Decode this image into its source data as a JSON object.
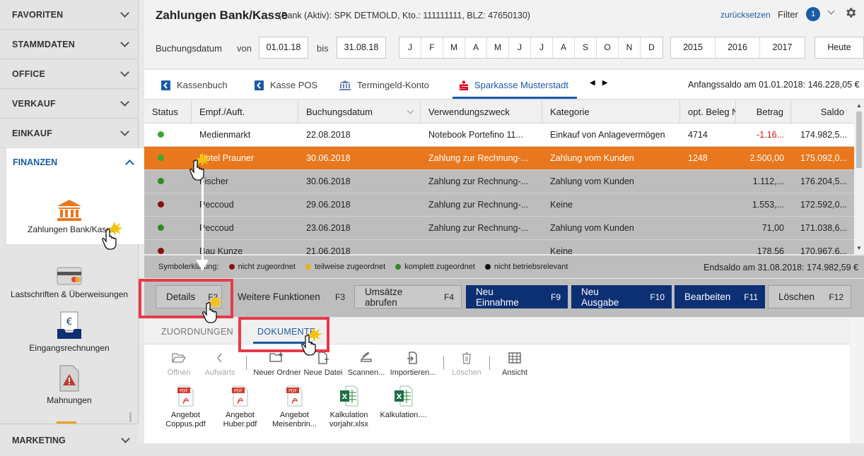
{
  "sidebar": {
    "items": [
      {
        "label": "FAVORITEN"
      },
      {
        "label": "STAMMDATEN"
      },
      {
        "label": "OFFICE"
      },
      {
        "label": "VERKAUF"
      },
      {
        "label": "EINKAUF"
      }
    ],
    "finanzen": {
      "label": "FINANZEN",
      "app_label": "Zahlungen Bank/Kasse"
    },
    "sub_items": [
      {
        "label": "Lastschriften & Überweisungen"
      },
      {
        "label": "Eingangsrechnungen"
      },
      {
        "label": "Mahnungen"
      }
    ],
    "marketing": {
      "label": "MARKETING"
    }
  },
  "header": {
    "title": "Zahlungen Bank/Kasse",
    "subtitle": "(Bank (Aktiv): SPK DETMOLD, Kto.: 111111111, BLZ: 47650130)",
    "reset": "zurücksetzen",
    "filter": "Filter",
    "filter_count": "1",
    "buchungsdatum_label": "Buchungsdatum",
    "von": "von",
    "bis": "bis",
    "date_from": "01.01.18",
    "date_to": "31.08.18",
    "months": [
      "J",
      "F",
      "M",
      "A",
      "M",
      "J",
      "J",
      "A",
      "S",
      "O",
      "N",
      "D"
    ],
    "years": [
      "2015",
      "2016",
      "2017"
    ],
    "heute": "Heute"
  },
  "tabs": {
    "items": [
      {
        "label": "Kassenbuch"
      },
      {
        "label": "Kasse POS"
      },
      {
        "label": "Termingeld-Konto"
      },
      {
        "label": "Sparkasse Musterstadt"
      }
    ],
    "anfangssaldo": "Anfangssaldo am 01.01.2018: 146.228,05 €"
  },
  "table": {
    "headers": [
      "Status",
      "Empf./Auft.",
      "Buchungsdatum",
      "Verwendungszweck",
      "Kategorie",
      "opt. Beleg N",
      "Betrag",
      "Saldo"
    ],
    "rows": [
      {
        "status_color": "#3aa82c",
        "empf": "Medienmarkt",
        "datum": "22.08.2018",
        "zweck": "Notebook Portefino 11...",
        "kategorie": "Einkauf von Anlagevermögen",
        "beleg": "4714",
        "betrag": "-1.16...",
        "saldo": "174.982,5..."
      },
      {
        "status_color": "#3aa82c",
        "empf": "Hotel Prauner",
        "datum": "30.06.2018",
        "zweck": "Zahlung zur Rechnung-...",
        "kategorie": "Zahlung vom Kunden",
        "beleg": "1248",
        "betrag": "2.500,00",
        "saldo": "175.092,0..."
      },
      {
        "status_color": "#2f8a22",
        "empf": "Fischer",
        "datum": "30.06.2018",
        "zweck": "Zahlung zur Rechnung-...",
        "kategorie": "Zahlung vom Kunden",
        "beleg": "",
        "betrag": "1.112,...",
        "saldo": "176.204,5..."
      },
      {
        "status_color": "#8b1010",
        "empf": "Peccoud",
        "datum": "29.06.2018",
        "zweck": "Zahlung zur Rechnung-...",
        "kategorie": "Keine",
        "beleg": "",
        "betrag": "1.553,...",
        "saldo": "172.592,0..."
      },
      {
        "status_color": "#2f8a22",
        "empf": "Peccoud",
        "datum": "23.06.2018",
        "zweck": "Zahlung zur Rechnung-...",
        "kategorie": "Zahlung vom Kunden",
        "beleg": "",
        "betrag": "71,00",
        "saldo": "171.038,6..."
      },
      {
        "status_color": "#8b1010",
        "empf": "Bau Kunze",
        "datum": "21.06.2018",
        "zweck": "",
        "kategorie": "Keine",
        "beleg": "",
        "betrag": "178,56",
        "saldo": "170.967,6..."
      }
    ]
  },
  "legend": {
    "label": "Symbolerklärung:",
    "items": [
      {
        "color": "#8b1010",
        "label": "nicht zugeordnet"
      },
      {
        "color": "#e8b318",
        "label": "teilweise zugeordnet"
      },
      {
        "color": "#2f8a22",
        "label": "komplett zugeordnet"
      },
      {
        "color": "#111111",
        "label": "nicht betriebsrelevant"
      }
    ],
    "endsaldo": "Endsaldo am 31.08.2018: 174.982,59 €"
  },
  "buttons": {
    "details": {
      "label": "Details",
      "key": "F2"
    },
    "weitere": {
      "label": "Weitere Funktionen",
      "key": "F3"
    },
    "umsaetze": {
      "label": "Umsätze abrufen",
      "key": "F4"
    },
    "einnahme": {
      "label": "Neu Einnahme",
      "key": "F9"
    },
    "ausgabe": {
      "label": "Neu Ausgabe",
      "key": "F10"
    },
    "bearbeiten": {
      "label": "Bearbeiten",
      "key": "F11"
    },
    "loeschen": {
      "label": "Löschen",
      "key": "F12"
    }
  },
  "panel": {
    "tabs": {
      "zuordnungen": "ZUORDNUNGEN",
      "dokumente": "DOKUMENTE"
    },
    "tools": {
      "oeffnen": "Öffnen",
      "aufwaerts": "Aufwärts",
      "neuer_ordner": "Neuer Ordner",
      "neue_datei": "Neue Datei",
      "scannen": "Scannen...",
      "importieren": "Importieren...",
      "loeschen": "Löschen",
      "ansicht": "Ansicht"
    },
    "files": [
      {
        "line1": "Angebot",
        "line2": "Coppus.pdf",
        "type": "pdf"
      },
      {
        "line1": "Angebot",
        "line2": "Huber.pdf",
        "type": "pdf"
      },
      {
        "line1": "Angebot",
        "line2": "Meisenbrin...",
        "type": "pdf"
      },
      {
        "line1": "Kalkulation",
        "line2": "vorjahr.xlsx",
        "type": "xlsx"
      },
      {
        "line1": "Kalkulation....",
        "line2": "",
        "type": "xlsx"
      }
    ]
  },
  "colors": {
    "accent": "#1c5aa6",
    "selected_row": "#e8771d",
    "primary_button": "#0d2f73",
    "highlight": "#e8394a"
  }
}
